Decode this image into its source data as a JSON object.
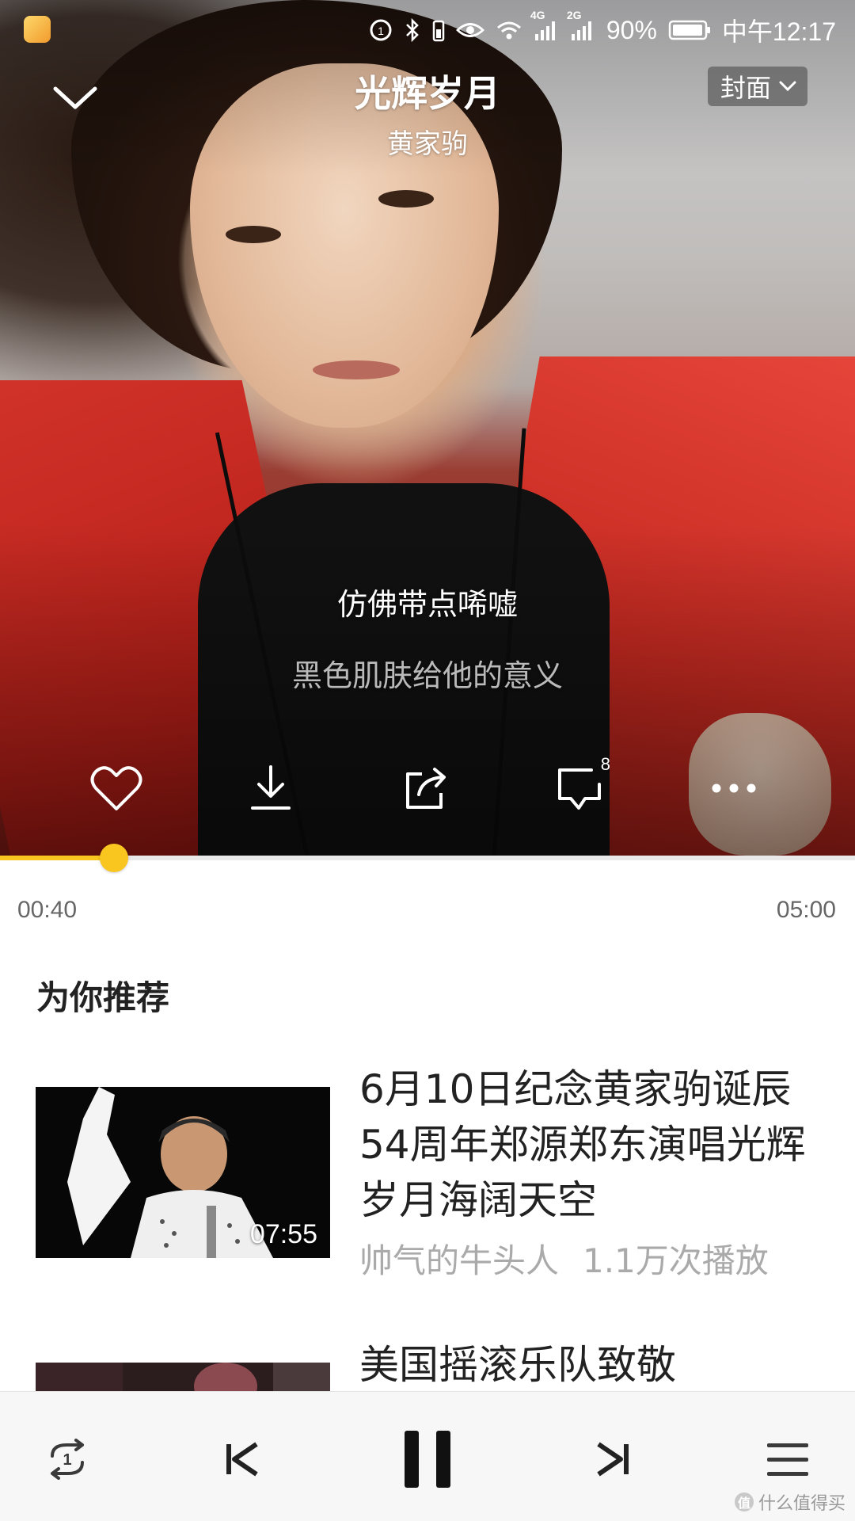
{
  "status_bar": {
    "network_4g": "4G",
    "network_2g": "2G",
    "battery": "90%",
    "time": "中午12:17"
  },
  "header": {
    "title": "光辉岁月",
    "artist": "黄家驹",
    "cover_toggle": "封面"
  },
  "lyrics": {
    "current": "仿佛带点唏嘘",
    "next": "黑色肌肤给他的意义"
  },
  "actions": {
    "comment_count": "8",
    "icons": [
      "heart-icon",
      "download-icon",
      "share-icon",
      "comment-icon",
      "more-icon"
    ]
  },
  "progress": {
    "elapsed": "00:40",
    "total": "05:00",
    "fraction": 0.1333,
    "accent_color": "#f9c51f"
  },
  "recommend": {
    "title": "为你推荐",
    "items": [
      {
        "title": "6月10日纪念黄家驹诞辰54周年郑源郑东演唱光辉岁月海阔天空",
        "duration": "07:55",
        "author": "帅气的牛头人",
        "plays": "1.1万次播放"
      },
      {
        "title": "美国摇滚乐队致敬"
      }
    ]
  },
  "player_bar": {
    "icons": [
      "repeat-one-icon",
      "previous-icon",
      "pause-icon",
      "next-icon",
      "playlist-icon"
    ]
  },
  "watermark": {
    "text": "什么值得买",
    "mark": "值"
  }
}
